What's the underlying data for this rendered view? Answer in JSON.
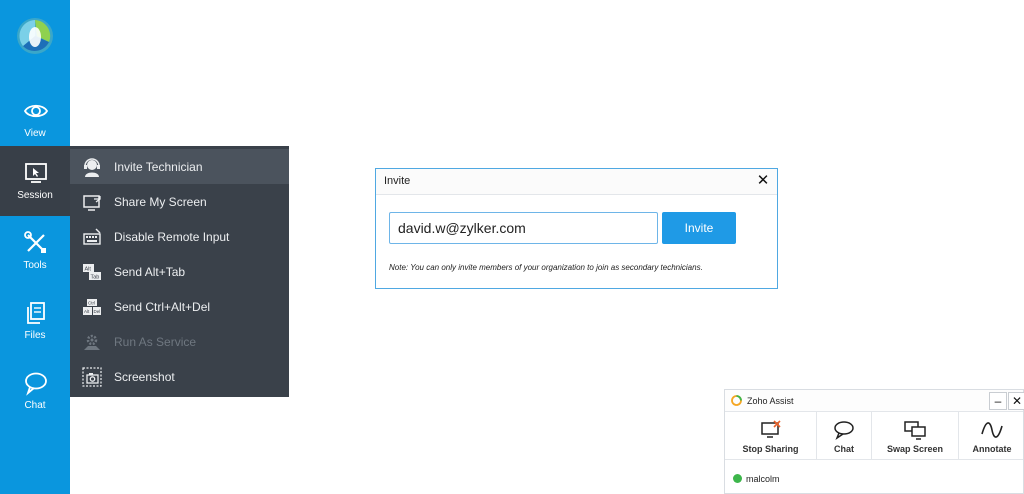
{
  "rail": {
    "items": [
      {
        "label": "View",
        "icon": "eye-icon"
      },
      {
        "label": "Session",
        "icon": "monitor-cursor-icon"
      },
      {
        "label": "Tools",
        "icon": "tools-icon"
      },
      {
        "label": "Files",
        "icon": "files-icon"
      },
      {
        "label": "Chat",
        "icon": "chat-icon"
      }
    ],
    "active": "Session"
  },
  "session_menu": {
    "items": [
      {
        "label": "Invite Technician",
        "icon": "technician-headset-icon",
        "highlighted": true
      },
      {
        "label": "Share My Screen",
        "icon": "share-screen-icon"
      },
      {
        "label": "Disable Remote Input",
        "icon": "keyboard-icon"
      },
      {
        "label": "Send Alt+Tab",
        "icon": "alt-tab-keys-icon"
      },
      {
        "label": "Send Ctrl+Alt+Del",
        "icon": "ctrl-alt-del-keys-icon"
      },
      {
        "label": "Run As Service",
        "icon": "gear-hand-icon",
        "disabled": true
      },
      {
        "label": "Screenshot",
        "icon": "camera-icon"
      }
    ]
  },
  "invite_dialog": {
    "title": "Invite",
    "email_value": "david.w@zylker.com",
    "invite_label": "Invite",
    "note": "Note: You can only invite members of your organization to join as secondary technicians."
  },
  "assist_bar": {
    "app_name": "Zoho Assist",
    "minimize_label": "–",
    "close_label": "✕",
    "tools": [
      {
        "label": "Stop Sharing",
        "icon": "stop-sharing-icon"
      },
      {
        "label": "Chat",
        "icon": "chat-bubble-icon"
      },
      {
        "label": "Swap Screen",
        "icon": "swap-screen-icon"
      },
      {
        "label": "Annotate",
        "icon": "annotate-wave-icon"
      }
    ],
    "user": "malcolm"
  },
  "colors": {
    "rail_bg": "#0a96de",
    "menu_bg": "#3a414a",
    "accent": "#1f9ae6",
    "online": "#3db64b"
  }
}
